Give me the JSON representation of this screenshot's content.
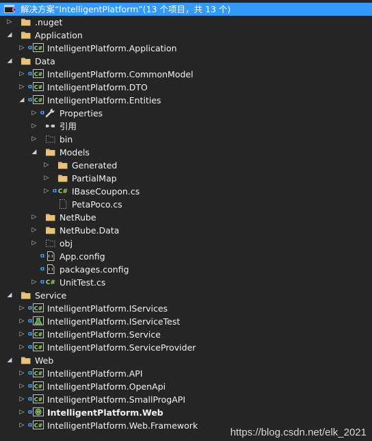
{
  "solution": {
    "label": "解决方案“IntelligentPlatform”(13 个项目，共 13 个)"
  },
  "tree": [
    {
      "label": ".nuget",
      "icon": "folder-icon",
      "level": 1,
      "expander": "collapsed"
    },
    {
      "label": "Application",
      "icon": "folder-icon",
      "level": 1,
      "expander": "expanded"
    },
    {
      "label": "IntelligentPlatform.Application",
      "icon": "csharp-project-icon",
      "level": 2,
      "expander": "collapsed",
      "locked": true
    },
    {
      "label": "Data",
      "icon": "folder-icon",
      "level": 1,
      "expander": "expanded"
    },
    {
      "label": "IntelligentPlatform.CommonModel",
      "icon": "csharp-project-icon",
      "level": 2,
      "expander": "collapsed",
      "locked": true
    },
    {
      "label": "IntelligentPlatform.DTO",
      "icon": "csharp-project-icon",
      "level": 2,
      "expander": "collapsed",
      "locked": true
    },
    {
      "label": "IntelligentPlatform.Entities",
      "icon": "csharp-project-icon",
      "level": 2,
      "expander": "expanded",
      "locked": true
    },
    {
      "label": "Properties",
      "icon": "wrench-icon",
      "level": 3,
      "expander": "collapsed",
      "locked": true
    },
    {
      "label": "引用",
      "icon": "references-icon",
      "level": 3,
      "expander": "collapsed"
    },
    {
      "label": "bin",
      "icon": "hidden-folder-icon",
      "level": 3,
      "expander": "collapsed"
    },
    {
      "label": "Models",
      "icon": "folder-icon",
      "level": 3,
      "expander": "expanded"
    },
    {
      "label": "Generated",
      "icon": "folder-icon",
      "level": 4,
      "expander": "collapsed"
    },
    {
      "label": "PartialMap",
      "icon": "folder-icon",
      "level": 4,
      "expander": "collapsed"
    },
    {
      "label": "IBaseCoupon.cs",
      "icon": "csharp-file-icon",
      "level": 4,
      "expander": "collapsed",
      "locked": true
    },
    {
      "label": "PetaPoco.cs",
      "icon": "hidden-file-icon",
      "level": 4,
      "expander": "none"
    },
    {
      "label": "NetRube",
      "icon": "folder-icon",
      "level": 3,
      "expander": "collapsed"
    },
    {
      "label": "NetRube.Data",
      "icon": "folder-icon",
      "level": 3,
      "expander": "collapsed"
    },
    {
      "label": "obj",
      "icon": "hidden-folder-icon",
      "level": 3,
      "expander": "collapsed"
    },
    {
      "label": "App.config",
      "icon": "config-file-icon",
      "level": 3,
      "expander": "none",
      "locked": true
    },
    {
      "label": "packages.config",
      "icon": "config-file-icon",
      "level": 3,
      "expander": "none",
      "locked": true
    },
    {
      "label": "UnitTest.cs",
      "icon": "csharp-file-icon",
      "level": 3,
      "expander": "collapsed",
      "locked": true
    },
    {
      "label": "Service",
      "icon": "folder-icon",
      "level": 1,
      "expander": "expanded"
    },
    {
      "label": "IntelligentPlatform.IServices",
      "icon": "csharp-project-icon",
      "level": 2,
      "expander": "collapsed",
      "locked": true
    },
    {
      "label": "IntelligentPlatform.IServiceTest",
      "icon": "test-project-icon",
      "level": 2,
      "expander": "collapsed",
      "locked": true
    },
    {
      "label": "IntelligentPlatform.Service",
      "icon": "csharp-project-icon",
      "level": 2,
      "expander": "collapsed",
      "locked": true
    },
    {
      "label": "IntelligentPlatform.ServiceProvider",
      "icon": "csharp-project-icon",
      "level": 2,
      "expander": "collapsed",
      "locked": true
    },
    {
      "label": "Web",
      "icon": "folder-icon",
      "level": 1,
      "expander": "expanded"
    },
    {
      "label": "IntelligentPlatform.API",
      "icon": "csharp-project-icon",
      "level": 2,
      "expander": "collapsed",
      "locked": true
    },
    {
      "label": "IntelligentPlatform.OpenApi",
      "icon": "csharp-project-icon",
      "level": 2,
      "expander": "collapsed",
      "locked": true
    },
    {
      "label": "IntelligentPlatform.SmallProgAPI",
      "icon": "csharp-project-icon",
      "level": 2,
      "expander": "collapsed",
      "locked": true
    },
    {
      "label": "IntelligentPlatform.Web",
      "icon": "web-project-icon",
      "level": 2,
      "expander": "collapsed",
      "locked": true,
      "bold": true
    },
    {
      "label": "IntelligentPlatform.Web.Framework",
      "icon": "csharp-project-icon",
      "level": 2,
      "expander": "collapsed",
      "locked": true
    }
  ],
  "watermark": "https://blog.csdn.net/elk_2021"
}
